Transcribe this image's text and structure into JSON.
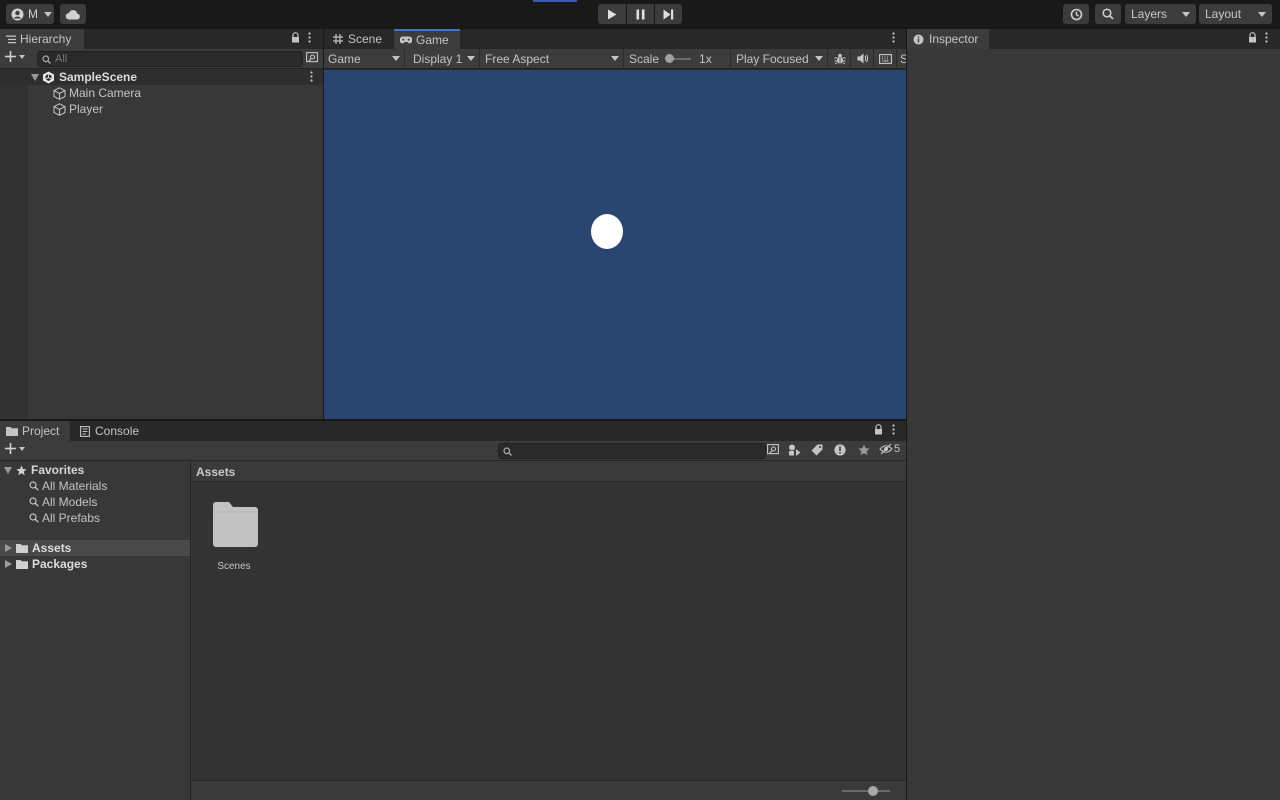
{
  "toolbar": {
    "account_label": "M",
    "layers_label": "Layers",
    "layout_label": "Layout"
  },
  "hierarchy": {
    "tab_label": "Hierarchy",
    "search_placeholder": "All",
    "scene_name": "SampleScene",
    "items": [
      {
        "label": "Main Camera"
      },
      {
        "label": "Player"
      }
    ]
  },
  "center_tabs": {
    "scene_label": "Scene",
    "game_label": "Game"
  },
  "game_toolbar": {
    "mode_label": "Game",
    "display_label": "Display 1",
    "aspect_label": "Free Aspect",
    "scale_label": "Scale",
    "scale_value": "1x",
    "play_focused_label": "Play Focused",
    "truncated_label": "S"
  },
  "game_view": {
    "background_color": "#2a4570",
    "ball_color": "#ffffff"
  },
  "inspector": {
    "tab_label": "Inspector"
  },
  "project": {
    "project_tab_label": "Project",
    "console_tab_label": "Console",
    "hidden_count": "5",
    "favorites_label": "Favorites",
    "favorites": [
      {
        "label": "All Materials"
      },
      {
        "label": "All Models"
      },
      {
        "label": "All Prefabs"
      }
    ],
    "assets_label": "Assets",
    "packages_label": "Packages",
    "breadcrumb": "Assets",
    "folders": [
      {
        "label": "Scenes"
      }
    ]
  }
}
